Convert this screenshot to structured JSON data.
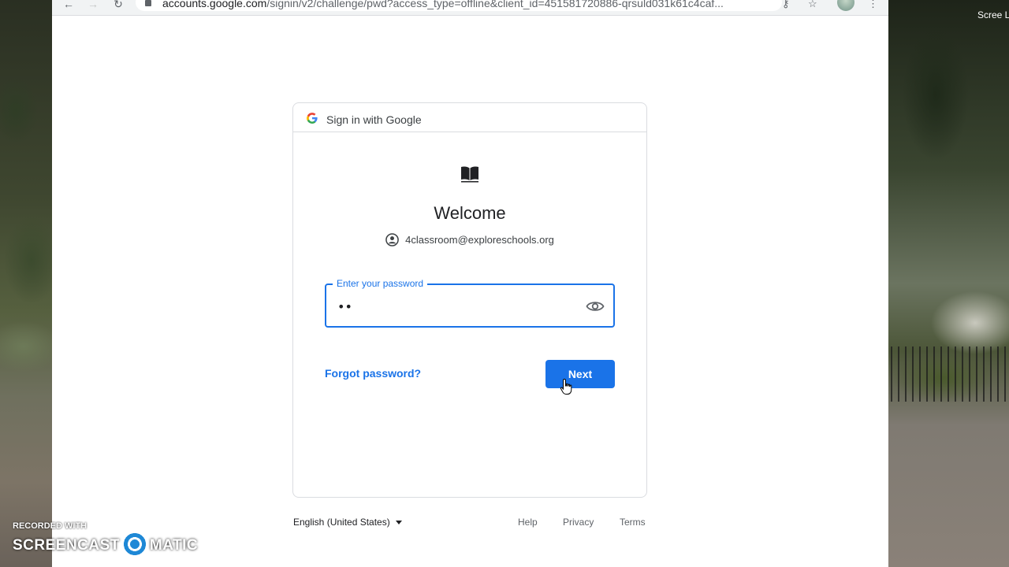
{
  "browser": {
    "url_host": "accounts.google.com",
    "url_rest": "/signin/v2/challenge/pwd?access_type=offline&client_id=451581720886-qrsuld031k61c4caf...",
    "icons": [
      "back-icon",
      "forward-icon",
      "reload-icon",
      "lock-icon",
      "key-icon",
      "star-icon",
      "menu-icon"
    ]
  },
  "desktop": {
    "corner_text": "Scree Launc"
  },
  "card": {
    "header_text": "Sign in with Google",
    "welcome": "Welcome",
    "account_email": "4classroom@exploreschools.org",
    "password": {
      "label": "Enter your password",
      "value": "••"
    },
    "forgot_label": "Forgot password?",
    "next_label": "Next"
  },
  "footer": {
    "language": "English (United States)",
    "links": {
      "help": "Help",
      "privacy": "Privacy",
      "terms": "Terms"
    }
  },
  "watermark": {
    "recorded": "RECORDED WITH",
    "brand_left": "SCREENCAST",
    "brand_right": "MATIC"
  },
  "colors": {
    "accent": "#1a73e8",
    "text": "#202124",
    "muted": "#5f6368",
    "border": "#dadce0"
  }
}
